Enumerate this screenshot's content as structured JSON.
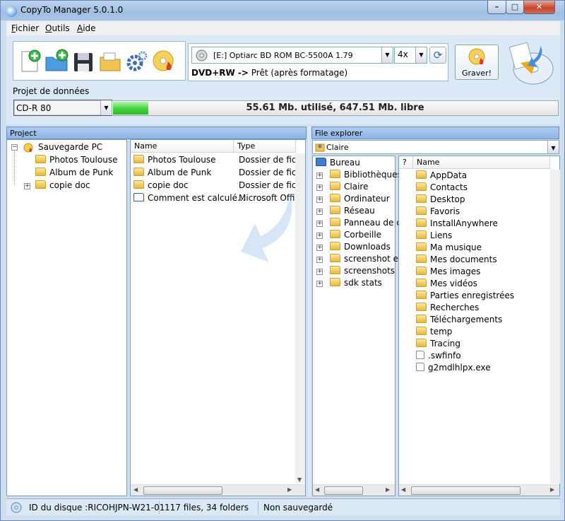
{
  "window": {
    "title": "CopyTo Manager 5.0.1.0",
    "min": "–",
    "max": "□",
    "close": "✕"
  },
  "menu": {
    "file": "Fichier",
    "tools": "Outils",
    "help": "Aide"
  },
  "toolbar": {
    "icons": [
      "new-project-icon",
      "add-folder-icon",
      "save-icon",
      "open-icon",
      "settings-icon",
      "burn-disc-icon"
    ],
    "drive": "[E:] Optiarc BD ROM BC-5500A 1.79",
    "speed": "4x",
    "media_type": "DVD+RW ->",
    "media_status": "Prêt (après formatage)",
    "burn_label": "Graver!"
  },
  "project": {
    "label": "Projet de données",
    "disk_type": "CD-R 80",
    "capacity_text": "55.61 Mb. utilisé, 647.51 Mb. libre",
    "used_fraction": 0.079
  },
  "project_panel": {
    "header": "Project",
    "tree": {
      "root": "Sauvegarde PC",
      "children": [
        "Photos Toulouse",
        "Album de Punk",
        "copie doc"
      ]
    },
    "columns": [
      "Name",
      "Type"
    ],
    "rows": [
      {
        "name": "Photos Toulouse",
        "type": "Dossier de fich"
      },
      {
        "name": "Album de Punk",
        "type": "Dossier de fich"
      },
      {
        "name": "copie doc",
        "type": "Dossier de fich"
      },
      {
        "name": "Comment est calculé...",
        "type": "Microsoft Offi"
      }
    ]
  },
  "explorer_panel": {
    "header": "File explorer",
    "path": "Claire",
    "tree": [
      "Bureau",
      "Bibliothèques",
      "Claire",
      "Ordinateur",
      "Réseau",
      "Panneau de co",
      "Corbeille",
      "Downloads",
      "screenshot exa",
      "screenshots",
      "sdk stats"
    ],
    "columns": [
      "?",
      "Name"
    ],
    "files": [
      "AppData",
      "Contacts",
      "Desktop",
      "Favoris",
      "InstallAnywhere",
      "Liens",
      "Ma musique",
      "Mes documents",
      "Mes images",
      "Mes vidéos",
      "Parties enregistrées",
      "Recherches",
      "Téléchargements",
      "temp",
      "Tracing",
      ".swfinfo",
      "g2mdlhlpx.exe"
    ]
  },
  "status": {
    "disc_id": "ID du disque :RICOHJPN-W21-01",
    "count": "117 files, 34 folders",
    "save_state": "Non sauvegardé"
  }
}
